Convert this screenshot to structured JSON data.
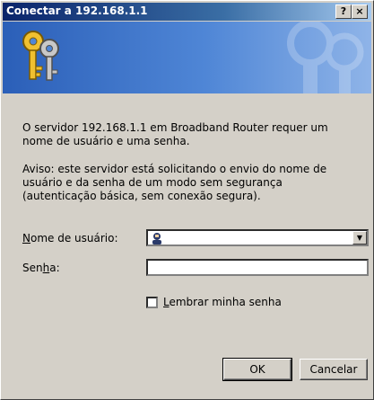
{
  "window": {
    "title": "Conectar a 192.168.1.1"
  },
  "titlebar": {
    "help_label": "?",
    "close_label": "×"
  },
  "message": {
    "intro": "O servidor 192.168.1.1 em Broadband Router requer um nome de usuário e uma senha.",
    "warning": "Aviso: este servidor está solicitando o envio do nome de usuário e da senha de um modo sem segurança (autenticação básica, sem conexão segura)."
  },
  "form": {
    "username_label_pre": "",
    "username_label_accel": "N",
    "username_label_post": "ome de usuário:",
    "username_value": "",
    "password_label_pre": "Sen",
    "password_label_accel": "h",
    "password_label_post": "a:",
    "password_value": "",
    "remember_label_pre": "",
    "remember_label_accel": "L",
    "remember_label_post": "embrar minha senha",
    "remember_checked": false
  },
  "buttons": {
    "ok": "OK",
    "cancel": "Cancelar"
  },
  "icons": {
    "banner": "keys-icon",
    "user": "user-icon",
    "dropdown": "chevron-down-icon"
  },
  "colors": {
    "title_start": "#0a246a",
    "title_end": "#a6caf0",
    "banner": "#4f86d6",
    "face": "#d4d0c8"
  }
}
